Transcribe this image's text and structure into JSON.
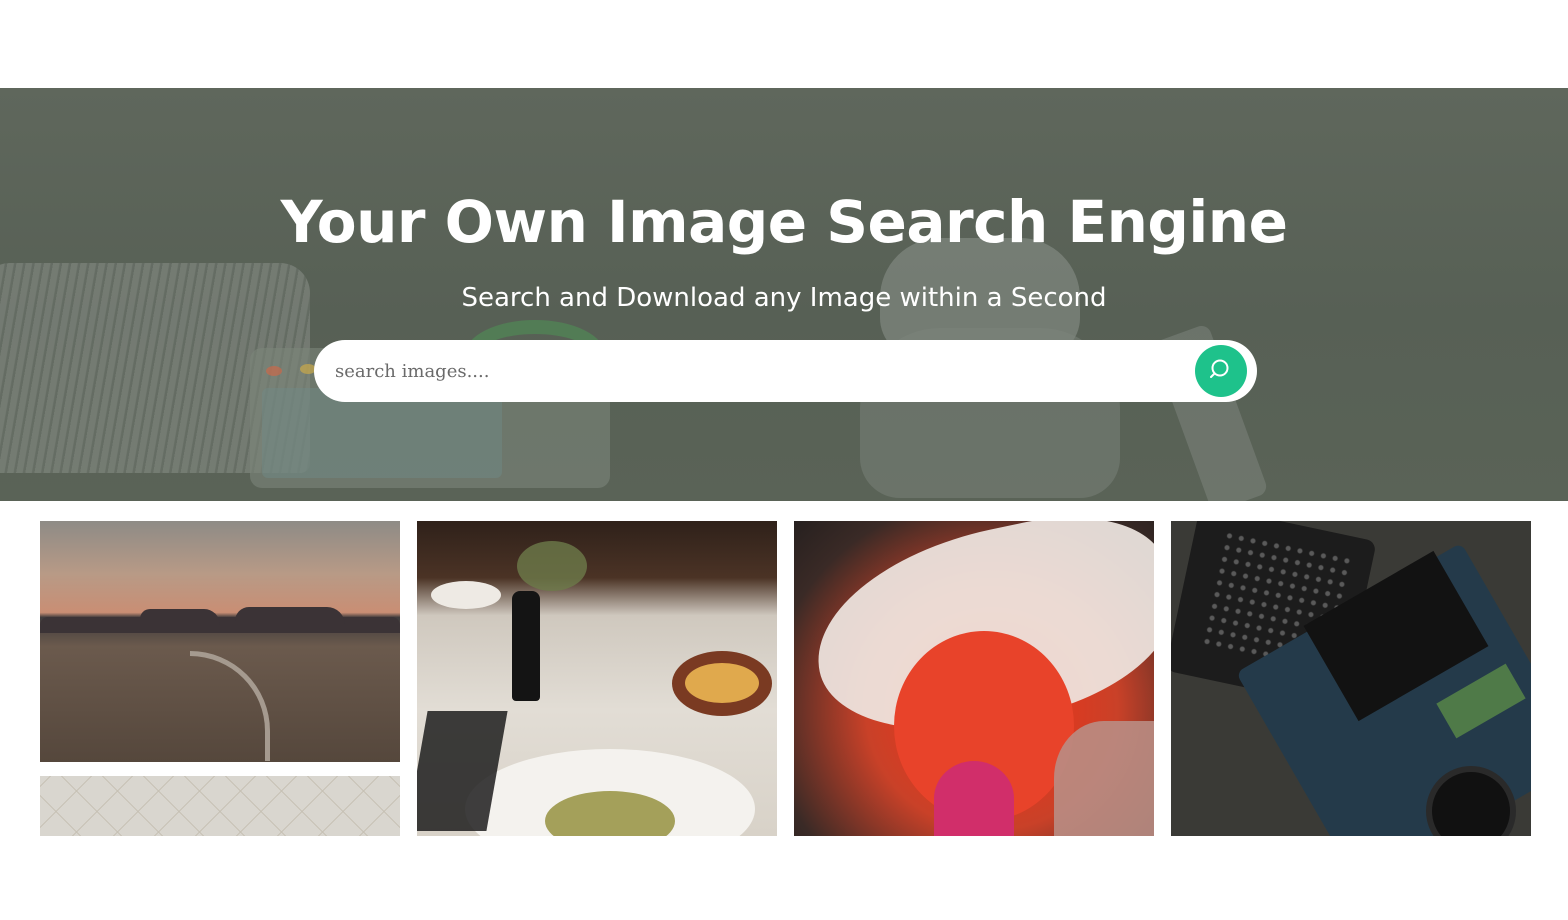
{
  "hero": {
    "title": "Your Own Image Search Engine",
    "subtitle": "Search and Download any Image within a Second",
    "background_overlay": "#5a6257"
  },
  "search": {
    "placeholder": "search images....",
    "value": "",
    "button_icon": "search-icon",
    "button_color": "#1ec28b"
  },
  "gallery": {
    "images": [
      {
        "subject": "desert-landscape-at-dusk"
      },
      {
        "subject": "restaurant-dinner-table"
      },
      {
        "subject": "flamingo-feathers-closeup"
      },
      {
        "subject": "laptop-internals-and-tools"
      },
      {
        "subject": "geometric-wallpaper-pattern"
      }
    ]
  }
}
